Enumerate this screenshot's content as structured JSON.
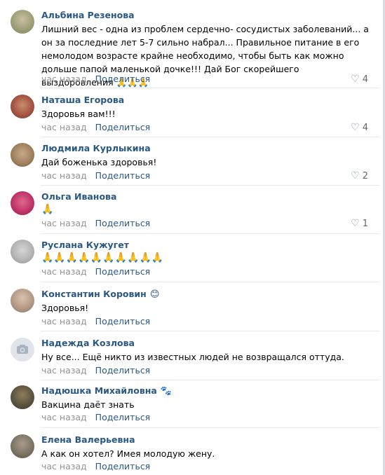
{
  "comments": [
    {
      "author": "Альбина Резенова",
      "text": "Лишний вес - одна из проблем сердечно- сосудистых заболеваний... а он за последние лет 5-7 сильно набрал... Правильное питание в его немолодом возрасте крайне необходимо, чтобы быть как можно дольше папой маленькой дочке!!! Дай Бог скорейшего выздоровления 🙏🙏🙏",
      "time": "час назад",
      "share": "Поделиться",
      "likes": "4",
      "avatar_color": "#b7b08a"
    },
    {
      "author": "Наташа Егорова",
      "text": "Здоровья вам!!!",
      "time": "час назад",
      "share": "Поделиться",
      "likes": "4",
      "avatar_color": "#b06a55"
    },
    {
      "author": "Людмила Курлыкина",
      "text": "Дай боженька здоровья!",
      "time": "час назад",
      "share": "Поделиться",
      "likes": "2",
      "avatar_color": "#a88a6a"
    },
    {
      "author": "Ольга Иванова",
      "text": "🙏",
      "time": "час назад",
      "share": "Поделиться",
      "likes": "1",
      "avatar_color": "#c0336b"
    },
    {
      "author": "Руслана Кужугет",
      "text": "🙏🙏🙏🙏🙏🙏🙏🙏🙏🙏",
      "time": "час назад",
      "share": "Поделиться",
      "likes": "",
      "avatar_color": "#b5b5b5"
    },
    {
      "author": "Константин Коровин",
      "author_emoji": "😊",
      "text": "Здоровья!",
      "time": "час назад",
      "share": "Поделиться",
      "likes": "",
      "avatar_color": "#b49a86"
    },
    {
      "author": "Надежда Козлова",
      "text": "Ну все... Ещё никто из известных людей не возвращался оттуда.",
      "time": "час назад",
      "share": "Поделиться",
      "likes": "",
      "avatar_color": "#e1e5eb"
    },
    {
      "author": "Надюшка Михайловна",
      "author_emoji": "🐾",
      "text": "Вакцина даёт знать",
      "time": "час назад",
      "share": "Поделиться",
      "likes": "",
      "avatar_color": "#6b6047"
    },
    {
      "author": "Елена Валерьевна",
      "text": "А как он хотел? Имея молодую жену.",
      "time": "час назад",
      "share": "Поделиться",
      "likes": "",
      "avatar_color": "#7e7465"
    }
  ],
  "colors": {
    "author": "#2a5885",
    "meta": "#939393",
    "separator": "#e7e8ec"
  },
  "icons": {
    "like": "heart-icon",
    "camera": "camera-icon"
  }
}
